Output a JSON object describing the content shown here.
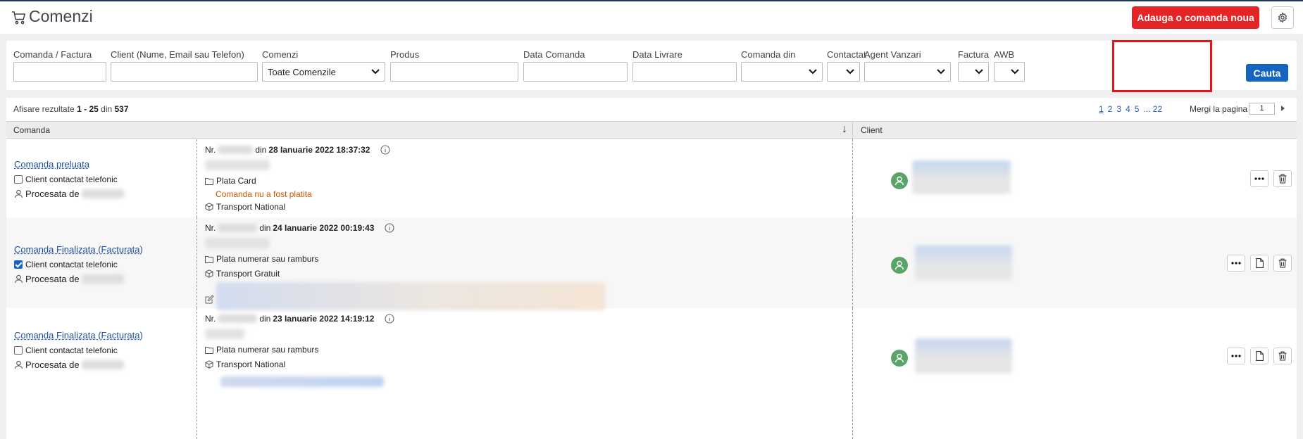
{
  "header": {
    "title": "Comenzi",
    "add_button": "Adauga o comanda noua"
  },
  "filters": {
    "order_invoice_label": "Comanda / Factura",
    "client_label": "Client (Nume, Email sau Telefon)",
    "orders_label": "Comenzi",
    "orders_value": "Toate Comenzile",
    "product_label": "Produs",
    "order_date_label": "Data Comanda",
    "delivery_date_label": "Data Livrare",
    "order_from_label": "Comanda din",
    "contacted_label": "Contactat",
    "sales_agent_label": "Agent Vanzari",
    "invoice_label": "Factura",
    "awb_label": "AWB",
    "search_button": "Cauta"
  },
  "results": {
    "prefix": "Afisare rezultate",
    "range_start": "1",
    "range_sep": "-",
    "range_end": "25",
    "of": "din",
    "total": "537",
    "pages": [
      "1",
      "2",
      "3",
      "4",
      "5",
      "... 22"
    ],
    "goto_label": "Mergi la pagina",
    "goto_value": "1"
  },
  "table": {
    "col_order": "Comanda",
    "sort_icon": "↓",
    "col_client": "Client"
  },
  "rows": [
    {
      "status": "Comanda preluata",
      "contacted_label": "Client contactat telefonic",
      "contacted": false,
      "processed_label": "Procesata de",
      "nr_label": "Nr.",
      "date_prefix": "din",
      "date": "28 Ianuarie 2022 18:37:32",
      "payment": "Plata Card",
      "payment_status": "Comanda nu a fost platita",
      "transport": "Transport National"
    },
    {
      "status": "Comanda Finalizata (Facturata)",
      "contacted_label": "Client contactat telefonic",
      "contacted": true,
      "processed_label": "Procesata de",
      "nr_label": "Nr.",
      "date_prefix": "din",
      "date": "24 Ianuarie 2022 00:19:43",
      "payment": "Plata numerar sau ramburs",
      "transport": "Transport Gratuit"
    },
    {
      "status": "Comanda Finalizata (Facturata)",
      "contacted_label": "Client contactat telefonic",
      "contacted": false,
      "processed_label": "Procesata de",
      "nr_label": "Nr.",
      "date_prefix": "din",
      "date": "23 Ianuarie 2022 14:19:12",
      "payment": "Plata numerar sau ramburs",
      "transport": "Transport National"
    }
  ],
  "icons": {
    "cart": "cart-icon",
    "settings": "gear-icon",
    "chevron": "chevron-down-icon",
    "user": "user-icon",
    "folder": "folder-icon",
    "box": "box-icon",
    "info": "info-icon",
    "edit": "edit-icon",
    "more": "more-icon",
    "document": "document-icon",
    "trash": "trash-icon"
  },
  "colors": {
    "primary_red": "#e42527",
    "primary_blue": "#1565c0",
    "link": "#1b4d99",
    "warning": "#d35400",
    "avatar": "#5aa46a",
    "highlight": "#e3151a"
  }
}
